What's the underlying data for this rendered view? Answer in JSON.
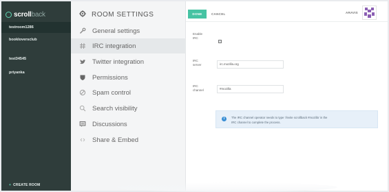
{
  "brand": {
    "name_bold": "scroll",
    "name_light": "back"
  },
  "rooms": [
    {
      "label": "testroom1286",
      "active": true
    },
    {
      "label": "bookloversclub",
      "active": false
    },
    {
      "label": "test34545",
      "active": false
    },
    {
      "label": "priyanka",
      "active": false
    }
  ],
  "create_room_label": "CREATE ROOM",
  "settings": {
    "title": "ROOM SETTINGS",
    "items": [
      {
        "label": "General settings",
        "icon": "wrench-icon",
        "active": false
      },
      {
        "label": "IRC integration",
        "icon": "hash-icon",
        "active": true
      },
      {
        "label": "Twitter integration",
        "icon": "twitter-bird-icon",
        "active": false
      },
      {
        "label": "Permissions",
        "icon": "shield-icon",
        "active": false
      },
      {
        "label": "Spam control",
        "icon": "block-icon",
        "active": false
      },
      {
        "label": "Search visibility",
        "icon": "magnifier-icon",
        "active": false
      },
      {
        "label": "Discussions",
        "icon": "chat-icon",
        "active": false
      },
      {
        "label": "Share & Embed",
        "icon": "share-icon",
        "active": false
      }
    ]
  },
  "toolbar": {
    "done_label": "DONE",
    "cancel_label": "CANCEL",
    "user_name": "ARAVIS"
  },
  "form": {
    "enable_irc_label_1": "Enable",
    "enable_irc_label_2": "IRC",
    "irc_server_label_1": "IRC",
    "irc_server_label_2": "server",
    "irc_server_value": "irc.mozilla.org",
    "irc_channel_label_1": "IRC",
    "irc_channel_label_2": "channel",
    "irc_channel_value": "#mozilla"
  },
  "info": {
    "line1": "The IRC channel operator needs to type '/invite scrollback #mozilla' in the",
    "line2": "IRC channel to complete the process."
  },
  "colors": {
    "accent": "#46c3a3",
    "sidebar": "#2f3d3b",
    "info_bg": "#e7f0f9",
    "avatar_purple": "#8b5fb3"
  }
}
